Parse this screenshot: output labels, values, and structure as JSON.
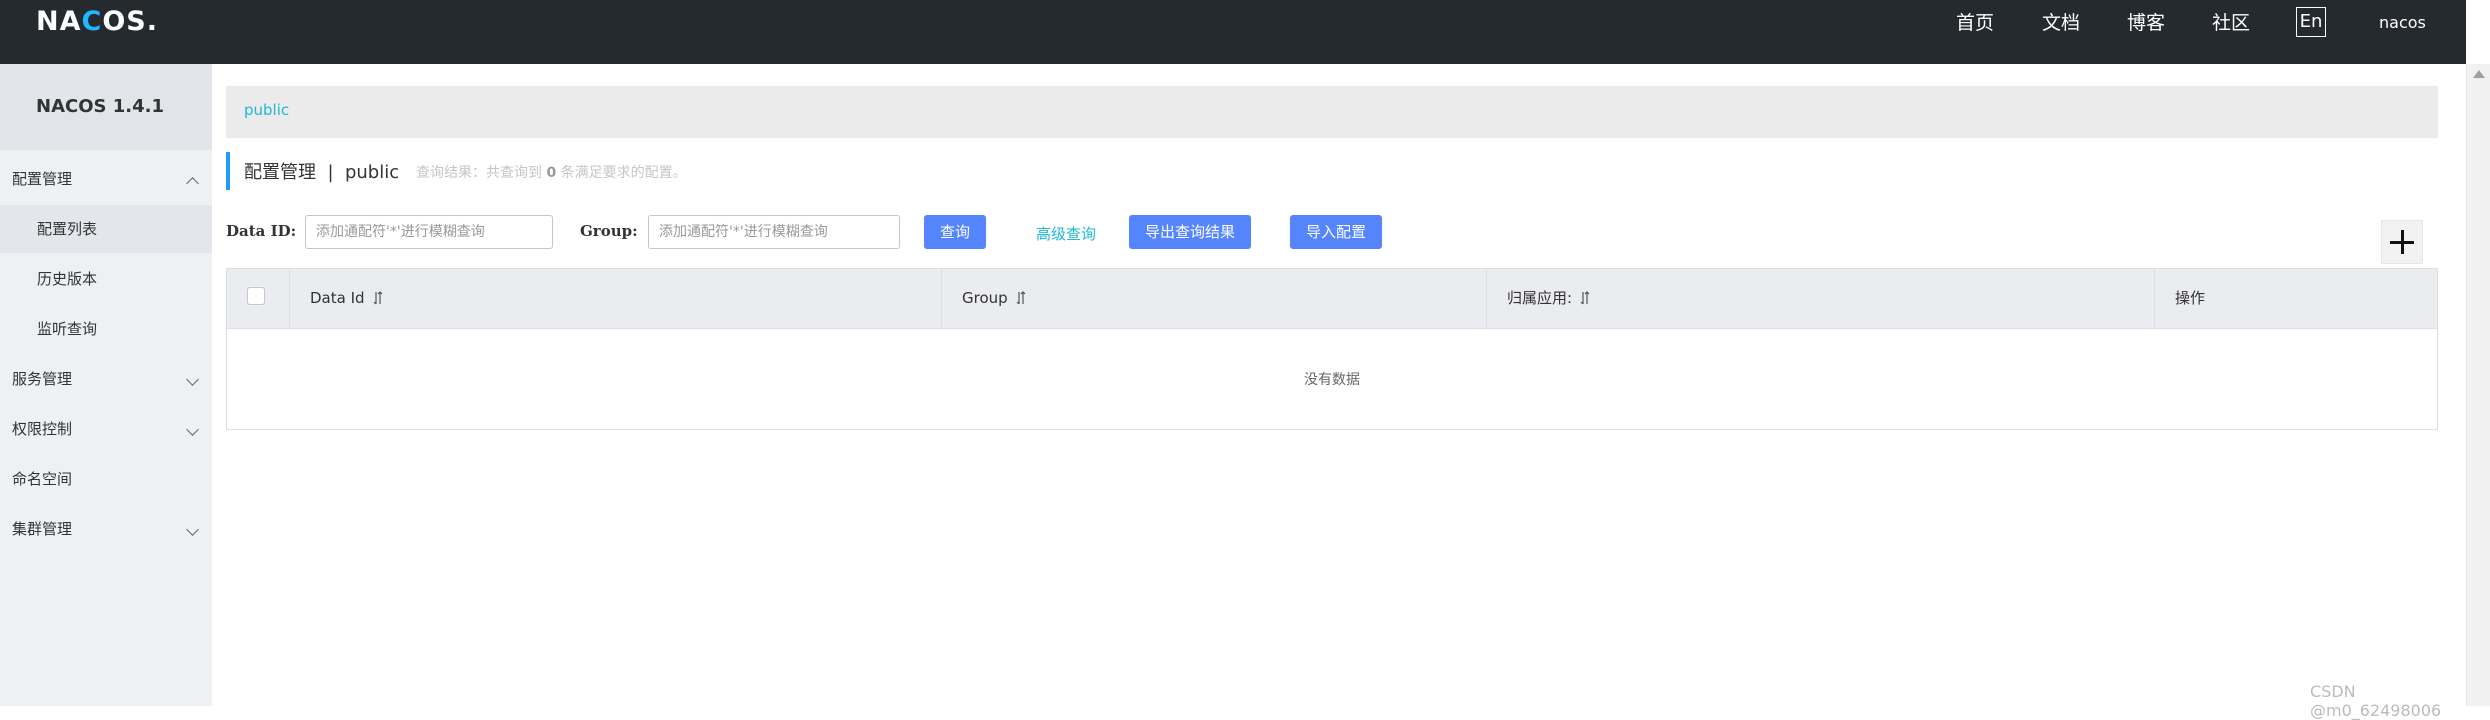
{
  "header": {
    "logo_text": "NACOS.",
    "nav": [
      "首页",
      "文档",
      "博客",
      "社区"
    ],
    "lang_button": "En",
    "user": "nacos"
  },
  "sidebar": {
    "title": "NACOS 1.4.1",
    "items": [
      {
        "label": "配置管理",
        "expanded": true
      },
      {
        "label": "配置列表",
        "active": true
      },
      {
        "label": "历史版本"
      },
      {
        "label": "监听查询"
      },
      {
        "label": "服务管理"
      },
      {
        "label": "权限控制"
      },
      {
        "label": "命名空间"
      },
      {
        "label": "集群管理"
      }
    ]
  },
  "breadcrumb": "public",
  "page": {
    "title": "配置管理  |  public",
    "query_prefix": "查询结果：共查询到",
    "query_count": "0",
    "query_suffix": "条满足要求的配置。"
  },
  "filters": {
    "data_id_label": "Data ID:",
    "data_id_placeholder": "添加通配符'*'进行模糊查询",
    "group_label": "Group:",
    "group_placeholder": "添加通配符'*'进行模糊查询",
    "search_button": "查询",
    "advanced_link": "高级查询",
    "export_button": "导出查询结果",
    "import_button": "导入配置"
  },
  "table": {
    "columns": [
      "Data Id",
      "Group",
      "归属应用:",
      "操作"
    ],
    "empty_text": "没有数据"
  },
  "watermark": "CSDN @m0_62498006",
  "colors": {
    "topbar": "#252a2f",
    "primary_button": "#5584ff",
    "link": "#1eb9d3",
    "accent_border": "#209bfa"
  }
}
